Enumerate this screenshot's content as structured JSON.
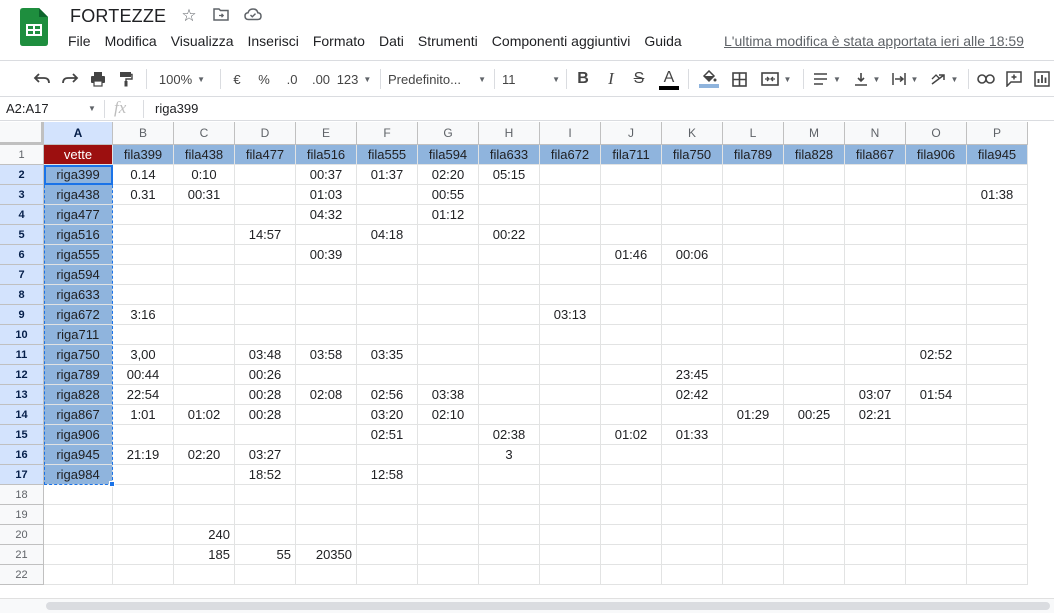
{
  "doc": {
    "title": "FORTEZZE",
    "last_edit": "L'ultima modifica è stata apportata ieri alle 18:59"
  },
  "menu": [
    "File",
    "Modifica",
    "Visualizza",
    "Inserisci",
    "Formato",
    "Dati",
    "Strumenti",
    "Componenti aggiuntivi",
    "Guida"
  ],
  "toolbar": {
    "zoom": "100%",
    "currency": "€",
    "percent": "%",
    "dec_less": ".0",
    "dec_more": ".00",
    "num_format": "123",
    "font": "Predefinito...",
    "font_size": "11",
    "bold": "B",
    "italic": "I",
    "strike": "S",
    "text_color": "A"
  },
  "formula_bar": {
    "name_box": "A2:A17",
    "fx": "fx",
    "value": "riga399"
  },
  "columns": [
    "A",
    "B",
    "C",
    "D",
    "E",
    "F",
    "G",
    "H",
    "I",
    "J",
    "K",
    "L",
    "M",
    "N",
    "O",
    "P"
  ],
  "rows": [
    "1",
    "2",
    "3",
    "4",
    "5",
    "6",
    "7",
    "8",
    "9",
    "10",
    "11",
    "12",
    "13",
    "14",
    "15",
    "16",
    "17",
    "18",
    "19",
    "20",
    "21",
    "22"
  ],
  "cells": [
    [
      "vette",
      "fila399",
      "fila438",
      "fila477",
      "fila516",
      "fila555",
      "fila594",
      "fila633",
      "fila672",
      "fila711",
      "fila750",
      "fila789",
      "fila828",
      "fila867",
      "fila906",
      "fila945"
    ],
    [
      "riga399",
      "0.14",
      "0:10",
      "",
      "00:37",
      "01:37",
      "02:20",
      "05:15",
      "",
      "",
      "",
      "",
      "",
      "",
      "",
      ""
    ],
    [
      "riga438",
      "0.31",
      "00:31",
      "",
      "01:03",
      "",
      "00:55",
      "",
      "",
      "",
      "",
      "",
      "",
      "",
      "",
      "01:38"
    ],
    [
      "riga477",
      "",
      "",
      "",
      "04:32",
      "",
      "01:12",
      "",
      "",
      "",
      "",
      "",
      "",
      "",
      "",
      ""
    ],
    [
      "riga516",
      "",
      "",
      "14:57",
      "",
      "04:18",
      "",
      "00:22",
      "",
      "",
      "",
      "",
      "",
      "",
      "",
      ""
    ],
    [
      "riga555",
      "",
      "",
      "",
      "00:39",
      "",
      "",
      "",
      "",
      "01:46",
      "00:06",
      "",
      "",
      "",
      "",
      ""
    ],
    [
      "riga594",
      "",
      "",
      "",
      "",
      "",
      "",
      "",
      "",
      "",
      "",
      "",
      "",
      "",
      "",
      ""
    ],
    [
      "riga633",
      "",
      "",
      "",
      "",
      "",
      "",
      "",
      "",
      "",
      "",
      "",
      "",
      "",
      "",
      ""
    ],
    [
      "riga672",
      "3:16",
      "",
      "",
      "",
      "",
      "",
      "",
      "03:13",
      "",
      "",
      "",
      "",
      "",
      "",
      ""
    ],
    [
      "riga711",
      "",
      "",
      "",
      "",
      "",
      "",
      "",
      "",
      "",
      "",
      "",
      "",
      "",
      "",
      ""
    ],
    [
      "riga750",
      "3,00",
      "",
      "03:48",
      "03:58",
      "03:35",
      "",
      "",
      "",
      "",
      "",
      "",
      "",
      "",
      "02:52",
      ""
    ],
    [
      "riga789",
      "00:44",
      "",
      "00:26",
      "",
      "",
      "",
      "",
      "",
      "",
      "23:45",
      "",
      "",
      "",
      "",
      ""
    ],
    [
      "riga828",
      "22:54",
      "",
      "00:28",
      "02:08",
      "02:56",
      "03:38",
      "",
      "",
      "",
      "02:42",
      "",
      "",
      "03:07",
      "01:54",
      ""
    ],
    [
      "riga867",
      "1:01",
      "01:02",
      "00:28",
      "",
      "03:20",
      "02:10",
      "",
      "",
      "",
      "",
      "01:29",
      "00:25",
      "02:21",
      "",
      ""
    ],
    [
      "riga906",
      "",
      "",
      "",
      "",
      "02:51",
      "",
      "02:38",
      "",
      "01:02",
      "01:33",
      "",
      "",
      "",
      "",
      ""
    ],
    [
      "riga945",
      "21:19",
      "02:20",
      "03:27",
      "",
      "",
      "",
      "3",
      "",
      "",
      "",
      "",
      "",
      "",
      "",
      ""
    ],
    [
      "riga984",
      "",
      "",
      "18:52",
      "",
      "12:58",
      "",
      "",
      "",
      "",
      "",
      "",
      "",
      "",
      "",
      ""
    ],
    [
      "",
      "",
      "",
      "",
      "",
      "",
      "",
      "",
      "",
      "",
      "",
      "",
      "",
      "",
      "",
      ""
    ],
    [
      "",
      "",
      "",
      "",
      "",
      "",
      "",
      "",
      "",
      "",
      "",
      "",
      "",
      "",
      "",
      ""
    ],
    [
      "",
      "",
      "240",
      "",
      "",
      "",
      "",
      "",
      "",
      "",
      "",
      "",
      "",
      "",
      "",
      ""
    ],
    [
      "",
      "",
      "185",
      "55",
      "20350",
      "",
      "",
      "",
      "",
      "",
      "",
      "",
      "",
      "",
      "",
      ""
    ],
    [
      "",
      "",
      "",
      "",
      "",
      "",
      "",
      "",
      "",
      "",
      "",
      "",
      "",
      "",
      "",
      ""
    ]
  ],
  "colors": {
    "header_row": "#8fb4dd",
    "header_a1": "#9c0f0f",
    "selection": "#1a73e8"
  }
}
